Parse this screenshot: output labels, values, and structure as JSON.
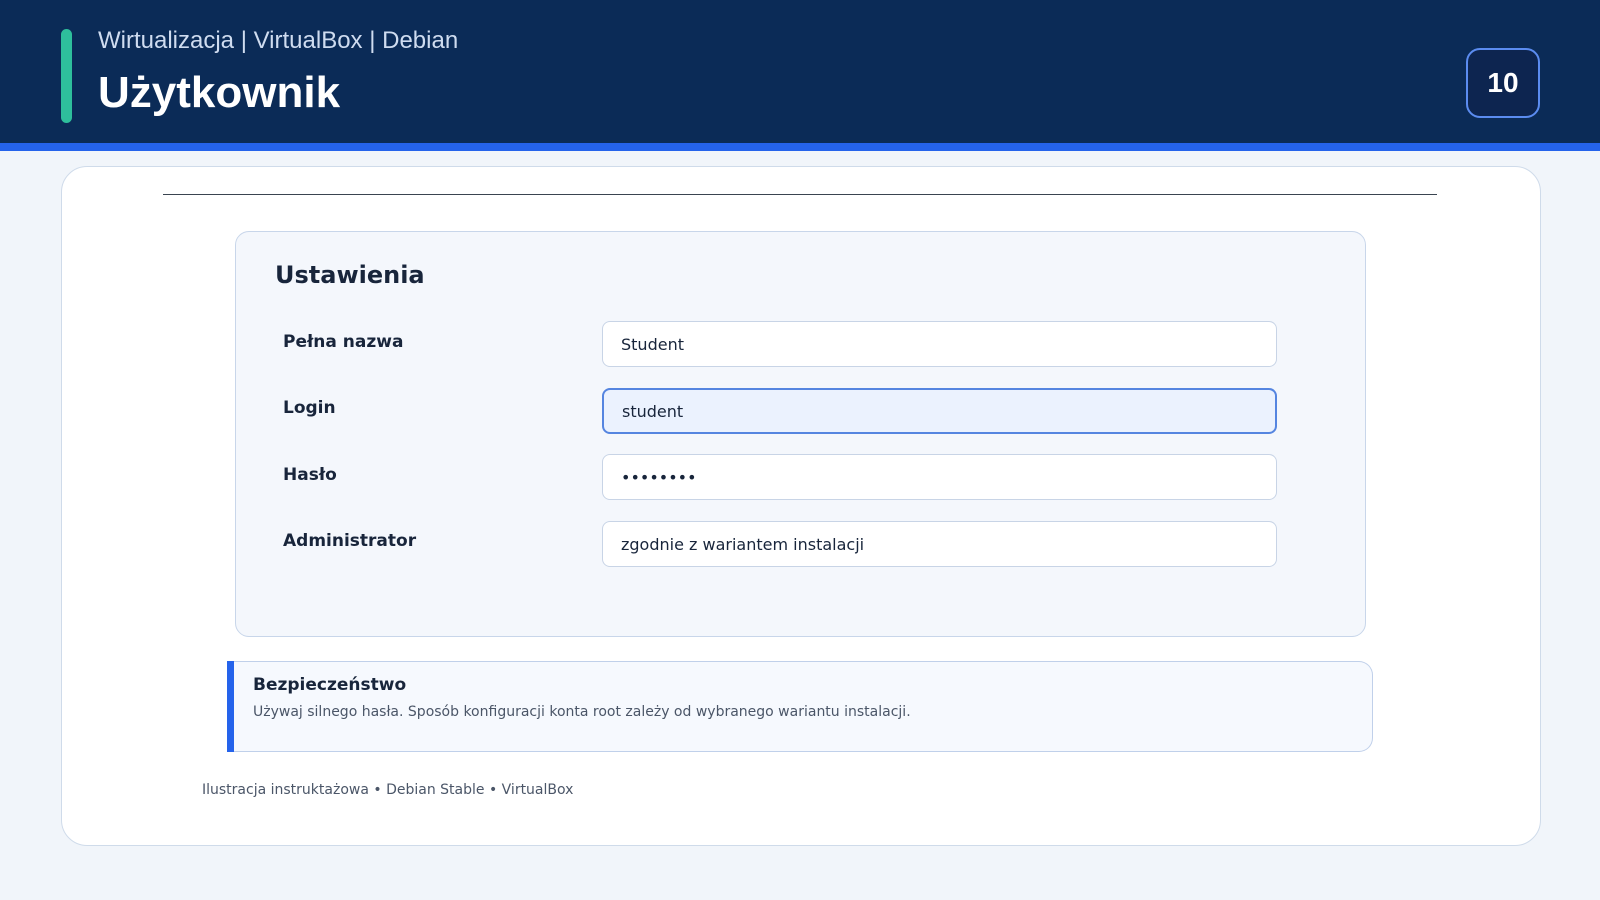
{
  "header": {
    "subtitle": "Wirtualizacja | VirtualBox | Debian",
    "title": "Użytkownik",
    "page_number": "10"
  },
  "settings": {
    "title": "Ustawienia",
    "fields": [
      {
        "label": "Pełna nazwa",
        "value": "Student"
      },
      {
        "label": "Login",
        "value": "student"
      },
      {
        "label": "Hasło",
        "value": "••••••••"
      },
      {
        "label": "Administrator",
        "value": "zgodnie z wariantem instalacji"
      }
    ]
  },
  "security": {
    "title": "Bezpieczeństwo",
    "text": "Używaj silnego hasła. Sposób konfiguracji konta root zależy od wybranego wariantu instalacji."
  },
  "footer": {
    "note": "Ilustracja instruktażowa • Debian Stable • VirtualBox"
  },
  "colors": {
    "header_bg": "#0b2b57",
    "accent_blue": "#2563eb",
    "accent_green": "#2ebf9c"
  }
}
